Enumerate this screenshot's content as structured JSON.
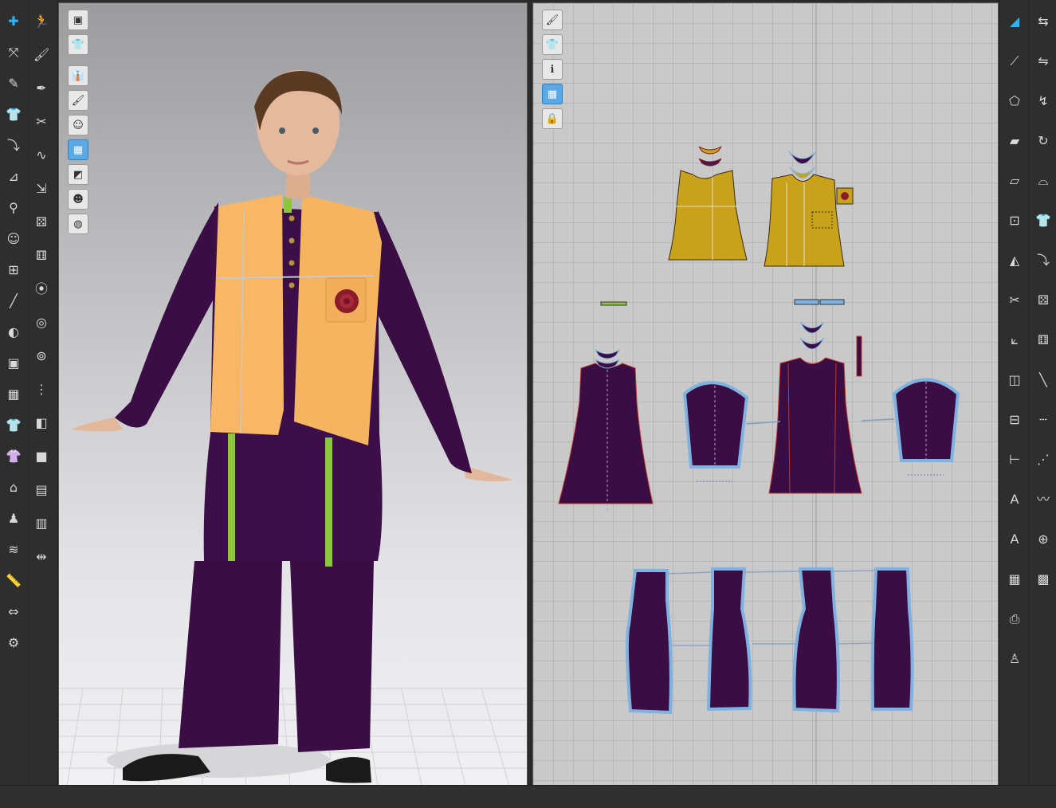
{
  "colors": {
    "toolbar_bg": "#2e2e2e",
    "accent": "#29b6f6",
    "kurta_purple": "#3a0d44",
    "vest_3d": "#f7b765",
    "vest_2d": "#c9a21c",
    "trim_green": "#8cc63f",
    "outline_blue": "#7fb2e0",
    "seam_red": "#c0392b"
  },
  "left_toolbar": {
    "col1": [
      "select-move-icon",
      "transform-pattern-icon",
      "edit-pattern-icon",
      "garment-icon",
      "fold-icon",
      "tack-icon",
      "pin-icon",
      "avatar-icon",
      "measure-icon",
      "line-icon",
      "sphere-icon",
      "texture-icon",
      "fabric-icon",
      "shirt-icon",
      "shirt-alt-icon",
      "hanger-icon",
      "walk-icon",
      "tape-icon",
      "ruler-icon",
      "shirt-fit-icon",
      "shirt-gear-icon"
    ],
    "col2": [
      "pose-icon",
      "brush-icon",
      "pen-icon",
      "needle-icon",
      "strap-icon",
      "stretch-icon",
      "knit-icon",
      "knit-alt-icon",
      "pointer-dot-icon",
      "button-icon",
      "buttonhole-icon",
      "zipper-icon",
      "cube-icon",
      "block-icon",
      "select-box-icon",
      "gradient-icon",
      "arrows-icon"
    ]
  },
  "right_toolbar": {
    "col1": [
      "create-pattern-icon",
      "segment-icon",
      "polygon-icon",
      "rectangle-icon",
      "internal-icon",
      "grade-icon",
      "dart-icon",
      "scissors-icon",
      "fold-arrange-icon",
      "symmetric-icon",
      "notch-icon",
      "length-icon",
      "text-icon",
      "font-icon",
      "grid-icon",
      "print-icon",
      "figure-icon"
    ],
    "col2": [
      "sew-icon",
      "segment-sew-icon",
      "free-sew-icon",
      "check-sew-icon",
      "iron-icon",
      "shirt-icon",
      "fold-icon",
      "knit-icon",
      "knit-alt-icon",
      "line-sew-icon",
      "dash-sew-icon",
      "stitch-icon",
      "zigzag-icon",
      "add-icon",
      "gift-icon"
    ]
  },
  "viewport_3d": {
    "tools": [
      "texture-icon",
      "shirt-icon",
      "shirt-view-icon",
      "brush-icon",
      "avatar-icon",
      "fabric-icon",
      "box-icon",
      "avatar-skin-icon",
      "globe-icon"
    ],
    "active_tool_index": 5
  },
  "viewport_2d": {
    "tools": [
      "brush-icon",
      "shirt-icon",
      "info-icon",
      "fabric-icon",
      "lock-icon"
    ],
    "active_tool_index": 3
  }
}
